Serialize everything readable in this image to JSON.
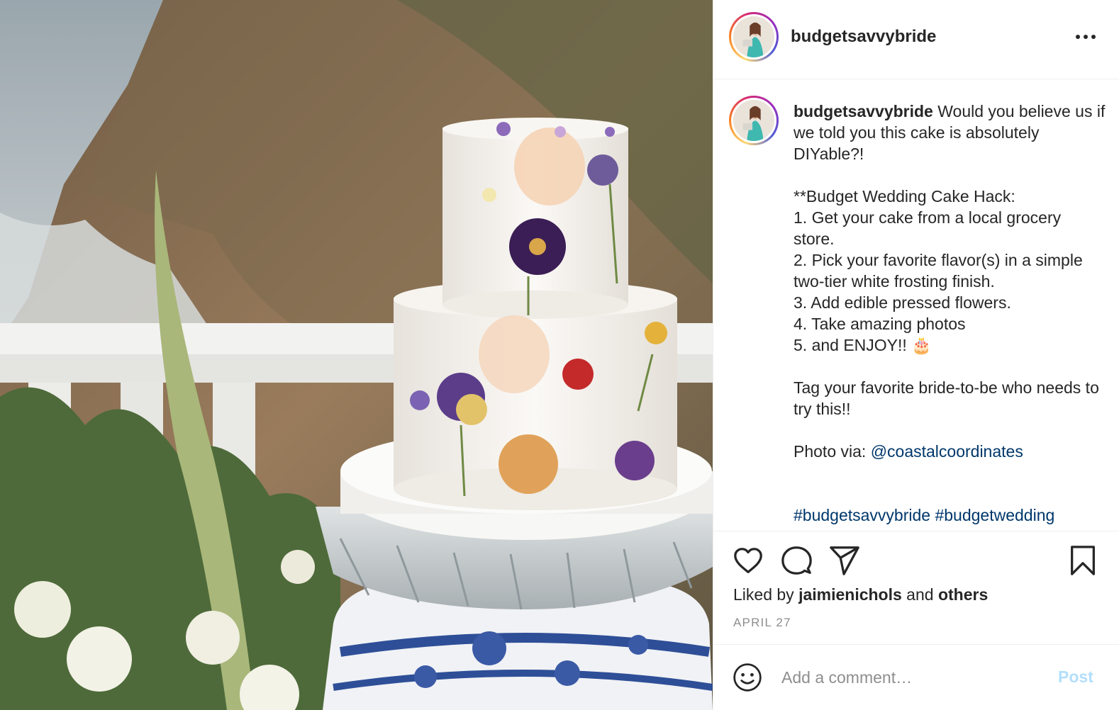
{
  "post": {
    "username": "budgetsavvybride",
    "caption": {
      "username": "budgetsavvybride",
      "text_main": " Would you believe us if we told you this cake is absolutely DIYable?!\n\n**Budget Wedding Cake Hack:\n1. Get your cake from a local grocery store.\n2. Pick your favorite flavor(s) in a simple two-tier white frosting finish.\n3. Add edible pressed flowers.\n4. Take amazing photos\n5. and ENJOY!! 🎂\n\nTag your favorite bride-to-be who needs to try this!!\n\nPhoto via: ",
      "mention": "@coastalcoordinates",
      "spacer": "\n\n\n",
      "hashtag_1": "#budgetsavvybride",
      "hashtag_2": "#budgetwedding"
    },
    "likes": {
      "prefix": "Liked by",
      "user": "jaimienichols",
      "conjunction": "and",
      "others": "others"
    },
    "date": "APRIL 27",
    "comment": {
      "placeholder": "Add a comment…",
      "post_label": "Post"
    }
  },
  "icons": {
    "more": "more-options-icon",
    "like": "heart-icon",
    "comment": "comment-icon",
    "share": "paper-plane-icon",
    "save": "bookmark-icon",
    "emoji": "smiley-icon"
  },
  "colors": {
    "text": "#262626",
    "muted": "#8e8e8e",
    "link": "#00376b",
    "post_button_disabled": "#b2dffc",
    "divider": "#efefef"
  }
}
